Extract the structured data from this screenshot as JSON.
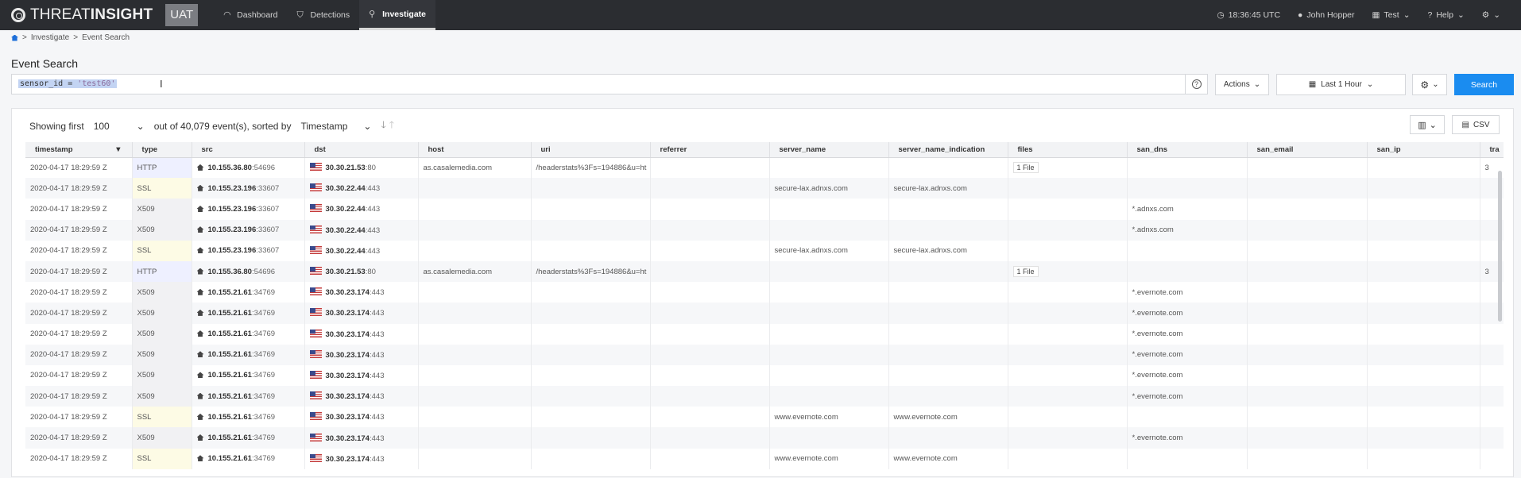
{
  "topbar": {
    "brand_light": "THREAT",
    "brand_bold": "INSIGHT",
    "env": "UAT",
    "nav": [
      {
        "label": "Dashboard",
        "icon": "gauge-icon",
        "active": false
      },
      {
        "label": "Detections",
        "icon": "shield-icon",
        "active": false
      },
      {
        "label": "Investigate",
        "icon": "search-icon",
        "active": true
      }
    ],
    "clock": "18:36:45 UTC",
    "user": "John Hopper",
    "org": "Test",
    "help": "Help"
  },
  "breadcrumb": {
    "items": [
      "Investigate",
      "Event Search"
    ]
  },
  "page": {
    "title": "Event Search"
  },
  "query": {
    "prefix": "sensor_id = ",
    "value": "'test60'",
    "actions_label": "Actions",
    "time_label": "Last 1 Hour",
    "search_label": "Search"
  },
  "results": {
    "showing_label": "Showing first",
    "count_value": "100",
    "out_of_label": "out of 40,079 event(s), sorted by",
    "sort_field": "Timestamp",
    "csv_label": "CSV"
  },
  "table": {
    "columns": [
      "timestamp",
      "type",
      "src",
      "dst",
      "host",
      "uri",
      "referrer",
      "server_name",
      "server_name_indication",
      "files",
      "san_dns",
      "san_email",
      "san_ip",
      "tra"
    ],
    "rows": [
      {
        "timestamp": "2020-04-17 18:29:59 Z",
        "type": "HTTP",
        "src_ip": "10.155.36.80",
        "src_port": ":54696",
        "dst_ip": "30.30.21.53",
        "dst_port": ":80",
        "host": "as.casalemedia.com",
        "uri": "/headerstats%3Fs=194886&u=ht",
        "server_name": "",
        "sni": "",
        "files": "1 File",
        "san_dns": "",
        "tra": "3"
      },
      {
        "timestamp": "2020-04-17 18:29:59 Z",
        "type": "SSL",
        "src_ip": "10.155.23.196",
        "src_port": ":33607",
        "dst_ip": "30.30.22.44",
        "dst_port": ":443",
        "host": "",
        "uri": "",
        "server_name": "secure-lax.adnxs.com",
        "sni": "secure-lax.adnxs.com",
        "files": "",
        "san_dns": "",
        "tra": ""
      },
      {
        "timestamp": "2020-04-17 18:29:59 Z",
        "type": "X509",
        "src_ip": "10.155.23.196",
        "src_port": ":33607",
        "dst_ip": "30.30.22.44",
        "dst_port": ":443",
        "host": "",
        "uri": "",
        "server_name": "",
        "sni": "",
        "files": "",
        "san_dns": "*.adnxs.com",
        "tra": ""
      },
      {
        "timestamp": "2020-04-17 18:29:59 Z",
        "type": "X509",
        "src_ip": "10.155.23.196",
        "src_port": ":33607",
        "dst_ip": "30.30.22.44",
        "dst_port": ":443",
        "host": "",
        "uri": "",
        "server_name": "",
        "sni": "",
        "files": "",
        "san_dns": "*.adnxs.com",
        "tra": ""
      },
      {
        "timestamp": "2020-04-17 18:29:59 Z",
        "type": "SSL",
        "src_ip": "10.155.23.196",
        "src_port": ":33607",
        "dst_ip": "30.30.22.44",
        "dst_port": ":443",
        "host": "",
        "uri": "",
        "server_name": "secure-lax.adnxs.com",
        "sni": "secure-lax.adnxs.com",
        "files": "",
        "san_dns": "",
        "tra": ""
      },
      {
        "timestamp": "2020-04-17 18:29:59 Z",
        "type": "HTTP",
        "src_ip": "10.155.36.80",
        "src_port": ":54696",
        "dst_ip": "30.30.21.53",
        "dst_port": ":80",
        "host": "as.casalemedia.com",
        "uri": "/headerstats%3Fs=194886&u=ht",
        "server_name": "",
        "sni": "",
        "files": "1 File",
        "san_dns": "",
        "tra": "3"
      },
      {
        "timestamp": "2020-04-17 18:29:59 Z",
        "type": "X509",
        "src_ip": "10.155.21.61",
        "src_port": ":34769",
        "dst_ip": "30.30.23.174",
        "dst_port": ":443",
        "host": "",
        "uri": "",
        "server_name": "",
        "sni": "",
        "files": "",
        "san_dns": "*.evernote.com",
        "tra": ""
      },
      {
        "timestamp": "2020-04-17 18:29:59 Z",
        "type": "X509",
        "src_ip": "10.155.21.61",
        "src_port": ":34769",
        "dst_ip": "30.30.23.174",
        "dst_port": ":443",
        "host": "",
        "uri": "",
        "server_name": "",
        "sni": "",
        "files": "",
        "san_dns": "*.evernote.com",
        "tra": ""
      },
      {
        "timestamp": "2020-04-17 18:29:59 Z",
        "type": "X509",
        "src_ip": "10.155.21.61",
        "src_port": ":34769",
        "dst_ip": "30.30.23.174",
        "dst_port": ":443",
        "host": "",
        "uri": "",
        "server_name": "",
        "sni": "",
        "files": "",
        "san_dns": "*.evernote.com",
        "tra": ""
      },
      {
        "timestamp": "2020-04-17 18:29:59 Z",
        "type": "X509",
        "src_ip": "10.155.21.61",
        "src_port": ":34769",
        "dst_ip": "30.30.23.174",
        "dst_port": ":443",
        "host": "",
        "uri": "",
        "server_name": "",
        "sni": "",
        "files": "",
        "san_dns": "*.evernote.com",
        "tra": ""
      },
      {
        "timestamp": "2020-04-17 18:29:59 Z",
        "type": "X509",
        "src_ip": "10.155.21.61",
        "src_port": ":34769",
        "dst_ip": "30.30.23.174",
        "dst_port": ":443",
        "host": "",
        "uri": "",
        "server_name": "",
        "sni": "",
        "files": "",
        "san_dns": "*.evernote.com",
        "tra": ""
      },
      {
        "timestamp": "2020-04-17 18:29:59 Z",
        "type": "X509",
        "src_ip": "10.155.21.61",
        "src_port": ":34769",
        "dst_ip": "30.30.23.174",
        "dst_port": ":443",
        "host": "",
        "uri": "",
        "server_name": "",
        "sni": "",
        "files": "",
        "san_dns": "*.evernote.com",
        "tra": ""
      },
      {
        "timestamp": "2020-04-17 18:29:59 Z",
        "type": "SSL",
        "src_ip": "10.155.21.61",
        "src_port": ":34769",
        "dst_ip": "30.30.23.174",
        "dst_port": ":443",
        "host": "",
        "uri": "",
        "server_name": "www.evernote.com",
        "sni": "www.evernote.com",
        "files": "",
        "san_dns": "",
        "tra": ""
      },
      {
        "timestamp": "2020-04-17 18:29:59 Z",
        "type": "X509",
        "src_ip": "10.155.21.61",
        "src_port": ":34769",
        "dst_ip": "30.30.23.174",
        "dst_port": ":443",
        "host": "",
        "uri": "",
        "server_name": "",
        "sni": "",
        "files": "",
        "san_dns": "*.evernote.com",
        "tra": ""
      },
      {
        "timestamp": "2020-04-17 18:29:59 Z",
        "type": "SSL",
        "src_ip": "10.155.21.61",
        "src_port": ":34769",
        "dst_ip": "30.30.23.174",
        "dst_port": ":443",
        "host": "",
        "uri": "",
        "server_name": "www.evernote.com",
        "sni": "www.evernote.com",
        "files": "",
        "san_dns": "",
        "tra": ""
      }
    ]
  }
}
